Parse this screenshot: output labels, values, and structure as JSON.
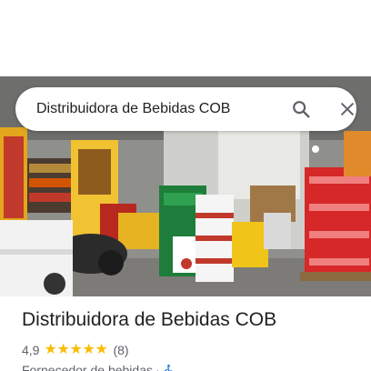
{
  "search": {
    "value": "Distribuidora de Bebidas COB",
    "search_icon": "search-icon",
    "close_icon": "close-icon"
  },
  "photo": {
    "description_icon": "store-photo"
  },
  "place": {
    "name": "Distribuidora de Bebidas COB",
    "rating": "4,9",
    "stars": 5,
    "review_count": "(8)",
    "category": "Fornecedor de bebidas",
    "separator": "·",
    "accessibility_icon": "wheelchair-icon"
  },
  "colors": {
    "star": "#fbbc04",
    "text_primary": "#202124",
    "text_secondary": "#5f6368",
    "accessibility": "#1a73e8"
  }
}
